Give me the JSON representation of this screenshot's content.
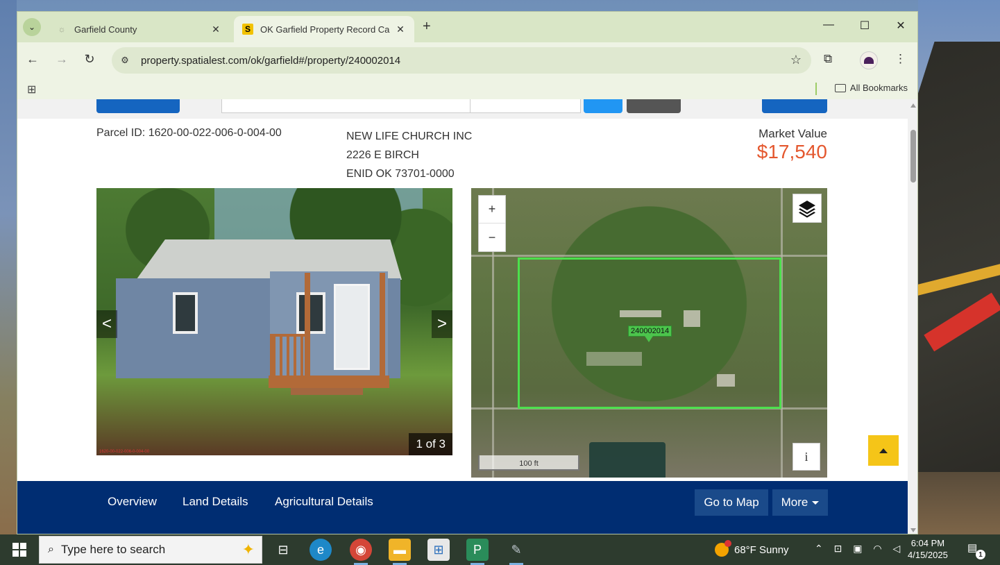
{
  "browser": {
    "tabs": [
      {
        "title": "Garfield County",
        "favicon": "globe-icon",
        "active": false
      },
      {
        "title": "OK Garfield Property Record Ca",
        "favicon": "S",
        "active": true
      }
    ],
    "url": "property.spatialest.com/ok/garfield#/property/240002014",
    "bookmarks_label": "All Bookmarks"
  },
  "property": {
    "parcel_id_text": "Parcel ID: 1620-00-022-006-0-004-00",
    "owner_name": "NEW LIFE CHURCH INC",
    "address_line1": "2226 E BIRCH",
    "address_line2": "ENID OK 73701-0000",
    "market_value_label": "Market Value",
    "market_value": "$17,540"
  },
  "photo": {
    "counter": "1 of 3",
    "caption": "1620-00-022-006-0-004-00",
    "prev": "<",
    "next": ">"
  },
  "map": {
    "parcel_label": "240002014",
    "zoom_in": "+",
    "zoom_out": "−",
    "scale": "100 ft",
    "info": "i"
  },
  "nav": {
    "items": [
      "Overview",
      "Land Details",
      "Agricultural Details"
    ],
    "go_to_map": "Go to Map",
    "more": "More"
  },
  "taskbar": {
    "search_placeholder": "Type here to search",
    "weather": "68°F  Sunny",
    "time": "6:04 PM",
    "date": "4/15/2025",
    "notification_count": "1"
  },
  "colors": {
    "accent_value": "#e4572e",
    "navbar": "#002d72",
    "back_to_top": "#f5c518",
    "parcel_outline": "#4ce04c"
  }
}
